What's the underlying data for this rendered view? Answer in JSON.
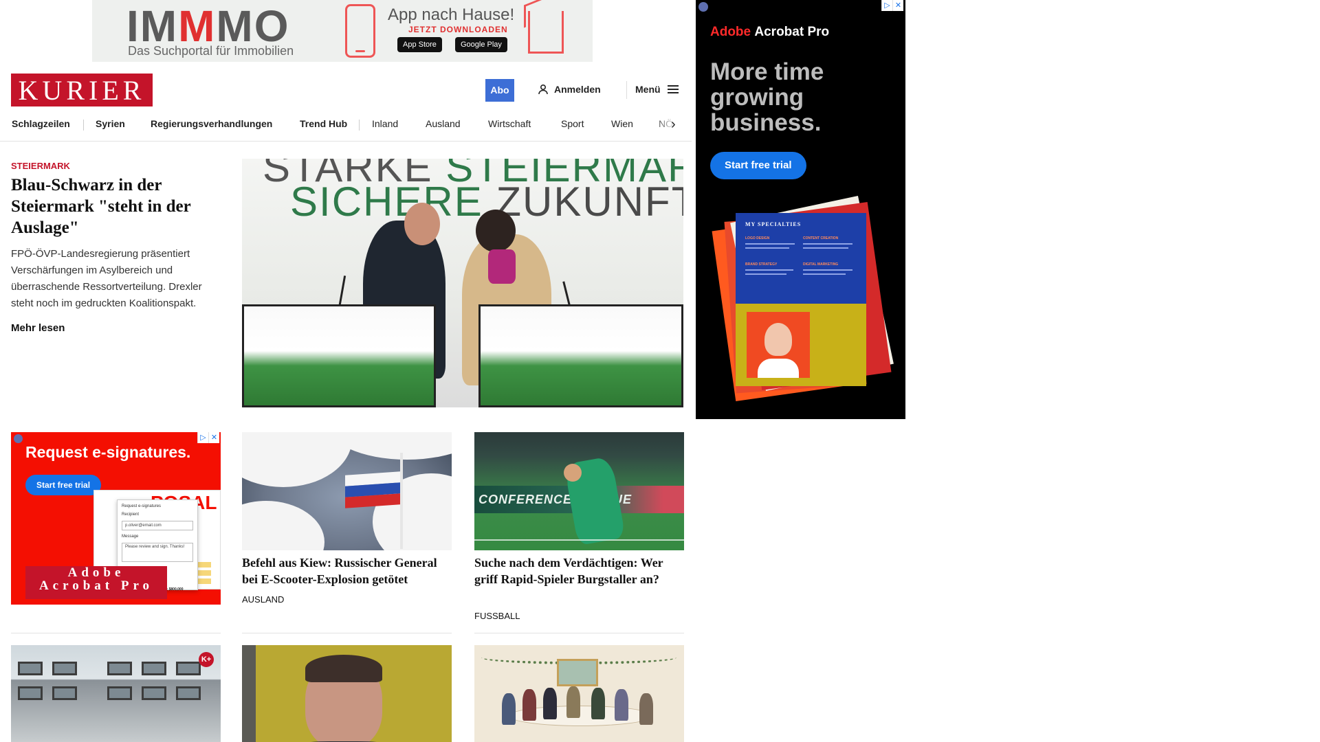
{
  "top_ad": {
    "brand_prefix": "IM",
    "brand_mid": "M",
    "brand_suffix": "MO",
    "tagline": "Das Suchportal für Immobilien",
    "headline": "App nach Hause!",
    "sub": "JETZT DOWNLOADEN",
    "store1": "App Store",
    "store2": "Google Play"
  },
  "header": {
    "logo": "KURIER",
    "abo": "Abo",
    "login": "Anmelden",
    "menu": "Menü"
  },
  "nav": {
    "items": [
      "Schlagzeilen",
      "Syrien",
      "Regierungsverhandlungen",
      "Trend Hub",
      "Inland",
      "Ausland",
      "Wirtschaft",
      "Sport",
      "Wien",
      "NÖ"
    ]
  },
  "lead": {
    "kicker": "STEIERMARK",
    "title": "Blau-Schwarz in der Steiermark \"steht in der Auslage\"",
    "teaser": "FPÖ-ÖVP-Landesregierung präsentiert Verschärfungen im Asylbereich und überraschende Ressortverteilung. Drexler steht noch im gedruckten Koalitionspakt.",
    "more": "Mehr lesen",
    "image_text1a": "STARKE",
    "image_text1b": "STEIERMARK.",
    "image_text2a": "SICHERE",
    "image_text2b": "ZUKUNFT."
  },
  "sky_ad": {
    "logo_brand": "Adobe",
    "logo_product": "Acrobat Pro",
    "headline": "More time growing business.",
    "cta": "Start free trial",
    "spec_title": "MY SPECIALTIES",
    "spec_cats": [
      "LOGO DESIGN",
      "CONTENT CREATION",
      "BRAND STRATEGY",
      "DIGITAL MARKETING"
    ],
    "adchoices": [
      "▷",
      "✕"
    ]
  },
  "square_ad": {
    "headline": "Request e-signatures.",
    "cta": "Start free trial",
    "logo_line1": "Adobe",
    "logo_line2": "Acrobat Pro",
    "doc_big": "POSAL",
    "form_title": "Request e-signatures",
    "recipient_label": "Recipient",
    "recipient_value": "p.oliver@email.com",
    "message_label": "Message",
    "message_value": "Please review and sign. Thanks!",
    "total": "Total Construction Cost: $800,000",
    "adchoices": [
      "▷",
      "✕"
    ]
  },
  "cards": [
    {
      "title": "Befehl aus Kiew: Russischer General bei E-Scooter-Explosion getötet",
      "kicker": "AUSLAND"
    },
    {
      "title": "Suche nach dem Verdächtigen: Wer griff Rapid-Spieler Burgstaller an?",
      "kicker": "FUSSBALL",
      "image_board": "CONFERENCE LEAGUE"
    }
  ],
  "colors": {
    "brand_red": "#c4142a",
    "abo_blue": "#3d6ed6",
    "adobe_red": "#f40f02",
    "adobe_blue": "#1473e6"
  },
  "icons": {
    "login": "user-icon",
    "menu": "hamburger-icon",
    "nav_next": "chevron-right-icon",
    "premium": "k-plus-badge-icon"
  }
}
